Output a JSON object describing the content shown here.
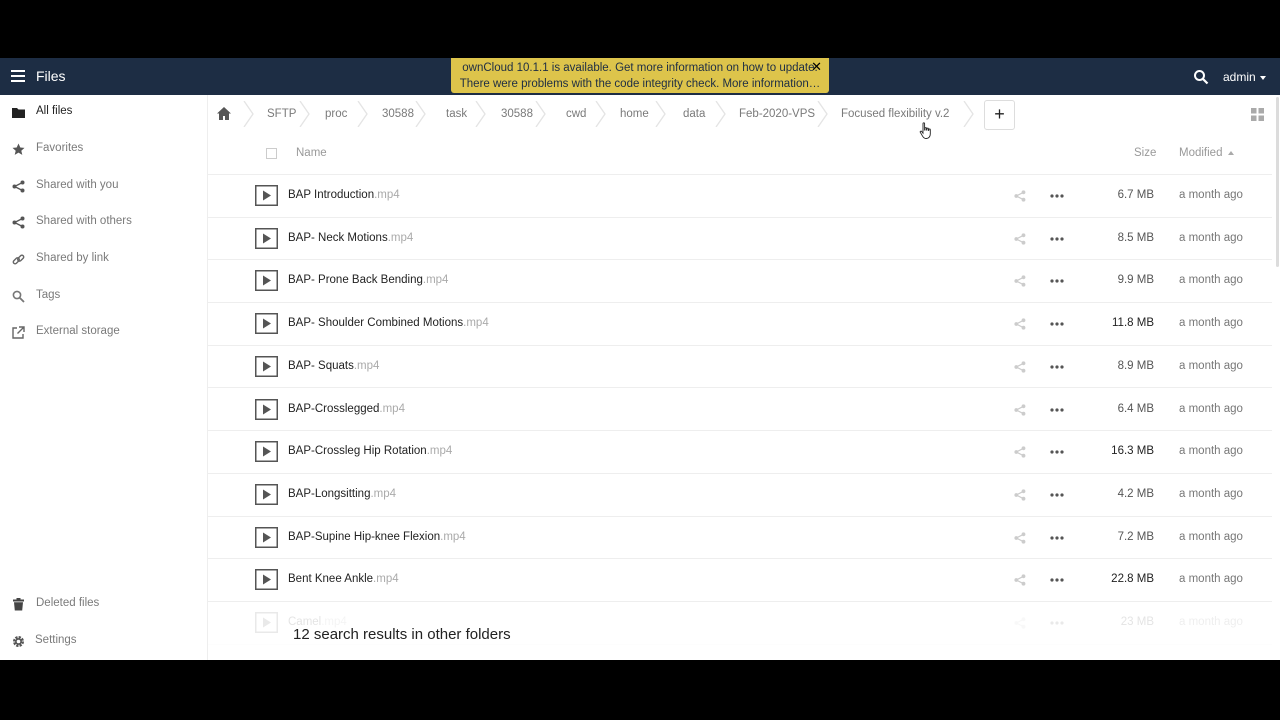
{
  "header": {
    "app_title": "Files",
    "user": "admin"
  },
  "notification": {
    "line1": "ownCloud 10.1.1 is available. Get more information on how to update.",
    "line2": "There were problems with the code integrity check. More information…",
    "close": "✕"
  },
  "sidebar": {
    "items": [
      {
        "label": "All files",
        "icon": "folder-icon"
      },
      {
        "label": "Favorites",
        "icon": "star-icon"
      },
      {
        "label": "Shared with you",
        "icon": "share-icon"
      },
      {
        "label": "Shared with others",
        "icon": "share-icon"
      },
      {
        "label": "Shared by link",
        "icon": "link-icon"
      },
      {
        "label": "Tags",
        "icon": "search-icon"
      },
      {
        "label": "External storage",
        "icon": "external-link-icon"
      }
    ],
    "deleted_files": "Deleted files",
    "settings": "Settings"
  },
  "breadcrumb": [
    "SFTP",
    "proc",
    "30588",
    "task",
    "30588",
    "cwd",
    "home",
    "data",
    "Feb-2020-VPS",
    "Focused flexibility v.2"
  ],
  "toolbar": {
    "new_label": "+"
  },
  "columns": {
    "name": "Name",
    "size": "Size",
    "modified": "Modified"
  },
  "files": [
    {
      "name": "BAP Introduction",
      "ext": ".mp4",
      "size": "6.7 MB",
      "modified": "a month ago"
    },
    {
      "name": "BAP- Neck Motions",
      "ext": ".mp4",
      "size": "8.5 MB",
      "modified": "a month ago"
    },
    {
      "name": "BAP- Prone Back Bending",
      "ext": ".mp4",
      "size": "9.9 MB",
      "modified": "a month ago"
    },
    {
      "name": "BAP- Shoulder Combined Motions",
      "ext": ".mp4",
      "size": "11.8 MB",
      "modified": "a month ago"
    },
    {
      "name": "BAP- Squats",
      "ext": ".mp4",
      "size": "8.9 MB",
      "modified": "a month ago"
    },
    {
      "name": "BAP-Crosslegged",
      "ext": ".mp4",
      "size": "6.4 MB",
      "modified": "a month ago"
    },
    {
      "name": "BAP-Crossleg Hip Rotation",
      "ext": ".mp4",
      "size": "16.3 MB",
      "modified": "a month ago"
    },
    {
      "name": "BAP-Longsitting",
      "ext": ".mp4",
      "size": "4.2 MB",
      "modified": "a month ago"
    },
    {
      "name": "BAP-Supine Hip-knee Flexion",
      "ext": ".mp4",
      "size": "7.2 MB",
      "modified": "a month ago"
    },
    {
      "name": "Bent Knee Ankle",
      "ext": ".mp4",
      "size": "22.8 MB",
      "modified": "a month ago"
    },
    {
      "name": "Camel",
      "ext": ".mp4",
      "size": "23 MB",
      "modified": "a month ago"
    }
  ],
  "search_results": "12 search results in other folders",
  "colors": {
    "header_bg": "#1d2d44",
    "notification_bg": "#ddc44b"
  }
}
